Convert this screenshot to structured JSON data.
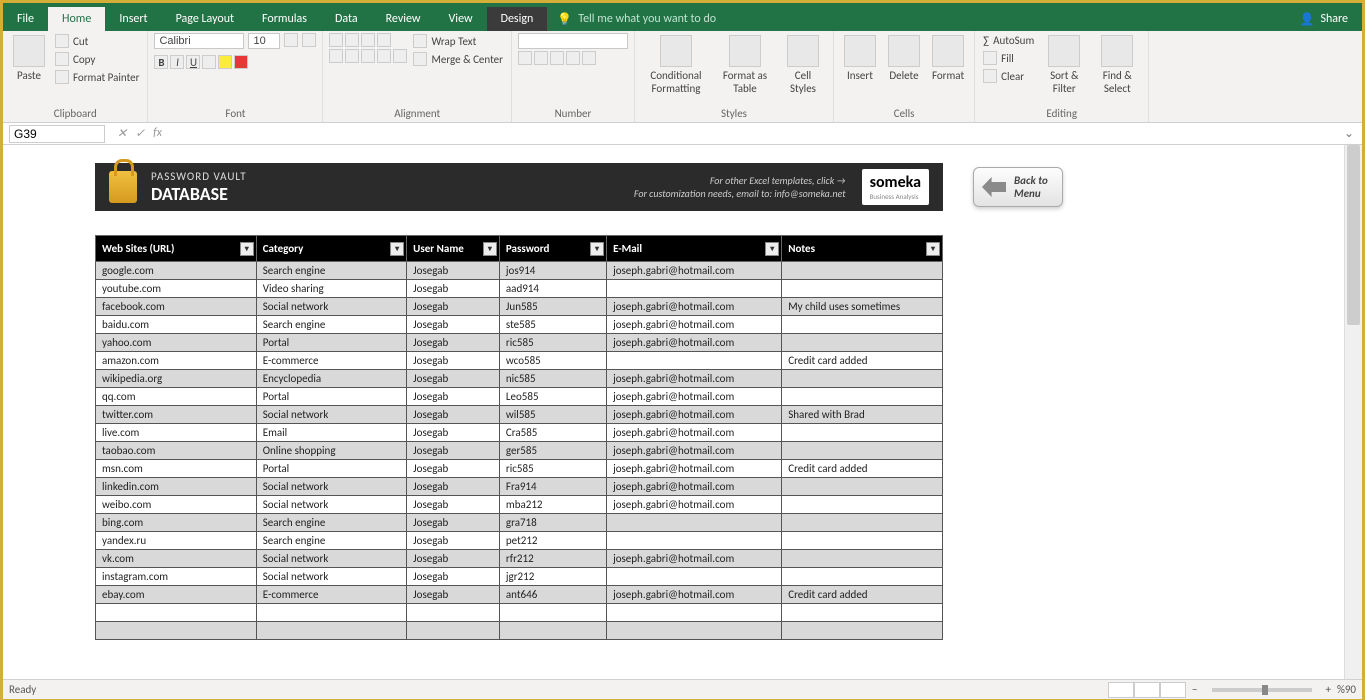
{
  "tabs": {
    "file": "File",
    "home": "Home",
    "insert": "Insert",
    "pageLayout": "Page Layout",
    "formulas": "Formulas",
    "data": "Data",
    "review": "Review",
    "view": "View",
    "design": "Design",
    "tellMe": "Tell me what you want to do",
    "share": "Share"
  },
  "ribbon": {
    "clipboard": {
      "paste": "Paste",
      "cut": "Cut",
      "copy": "Copy",
      "fp": "Format Painter",
      "label": "Clipboard"
    },
    "font": {
      "name": "Calibri",
      "size": "10",
      "label": "Font"
    },
    "align": {
      "wrap": "Wrap Text",
      "merge": "Merge & Center",
      "label": "Alignment"
    },
    "number": {
      "label": "Number"
    },
    "styles": {
      "cf": "Conditional Formatting",
      "fat": "Format as Table",
      "cs": "Cell Styles",
      "label": "Styles"
    },
    "cells": {
      "insert": "Insert",
      "delete": "Delete",
      "format": "Format",
      "label": "Cells"
    },
    "editing": {
      "autosum": "AutoSum",
      "fill": "Fill",
      "clear": "Clear",
      "sort": "Sort & Filter",
      "find": "Find & Select",
      "label": "Editing"
    }
  },
  "namebox": "G39",
  "vault": {
    "sub": "PASSWORD VAULT",
    "main": "DATABASE",
    "line1": "For other Excel templates, click →",
    "line2": "For customization needs, email to: info@someka.net",
    "brand": "someka",
    "brandsub": "Business Analysis",
    "back1": "Back to",
    "back2": "Menu"
  },
  "headers": [
    "Web Sites (URL)",
    "Category",
    "User Name",
    "Password",
    "E-Mail",
    "Notes"
  ],
  "rows": [
    [
      "google.com",
      "Search engine",
      "Josegab",
      "jos914",
      "joseph.gabri@hotmail.com",
      ""
    ],
    [
      "youtube.com",
      "Video sharing",
      "Josegab",
      "aad914",
      "",
      ""
    ],
    [
      "facebook.com",
      "Social network",
      "Josegab",
      "Jun585",
      "joseph.gabri@hotmail.com",
      "My child uses sometimes"
    ],
    [
      "baidu.com",
      "Search engine",
      "Josegab",
      "ste585",
      "joseph.gabri@hotmail.com",
      ""
    ],
    [
      "yahoo.com",
      "Portal",
      "Josegab",
      "ric585",
      "joseph.gabri@hotmail.com",
      ""
    ],
    [
      "amazon.com",
      "E-commerce",
      "Josegab",
      "wco585",
      "",
      "Credit card added"
    ],
    [
      "wikipedia.org",
      "Encyclopedia",
      "Josegab",
      "nic585",
      "joseph.gabri@hotmail.com",
      ""
    ],
    [
      "qq.com",
      "Portal",
      "Josegab",
      "Leo585",
      "joseph.gabri@hotmail.com",
      ""
    ],
    [
      "twitter.com",
      "Social network",
      "Josegab",
      "wil585",
      "joseph.gabri@hotmail.com",
      "Shared with Brad"
    ],
    [
      "live.com",
      "Email",
      "Josegab",
      "Cra585",
      "joseph.gabri@hotmail.com",
      ""
    ],
    [
      "taobao.com",
      "Online shopping",
      "Josegab",
      "ger585",
      "joseph.gabri@hotmail.com",
      ""
    ],
    [
      "msn.com",
      "Portal",
      "Josegab",
      "ric585",
      "joseph.gabri@hotmail.com",
      "Credit card added"
    ],
    [
      "linkedin.com",
      "Social network",
      "Josegab",
      "Fra914",
      "joseph.gabri@hotmail.com",
      ""
    ],
    [
      "weibo.com",
      "Social network",
      "Josegab",
      "mba212",
      "joseph.gabri@hotmail.com",
      ""
    ],
    [
      "bing.com",
      "Search engine",
      "Josegab",
      "gra718",
      "",
      ""
    ],
    [
      "yandex.ru",
      "Search engine",
      "Josegab",
      "pet212",
      "",
      ""
    ],
    [
      "vk.com",
      "Social network",
      "Josegab",
      "rfr212",
      "joseph.gabri@hotmail.com",
      ""
    ],
    [
      "instagram.com",
      "Social network",
      "Josegab",
      "jgr212",
      "",
      ""
    ],
    [
      "ebay.com",
      "E-commerce",
      "Josegab",
      "ant646",
      "joseph.gabri@hotmail.com",
      "Credit card added"
    ],
    [
      "",
      "",
      "",
      "",
      "",
      ""
    ],
    [
      "",
      "",
      "",
      "",
      "",
      ""
    ]
  ],
  "status": {
    "ready": "Ready",
    "zoom": "%90"
  }
}
